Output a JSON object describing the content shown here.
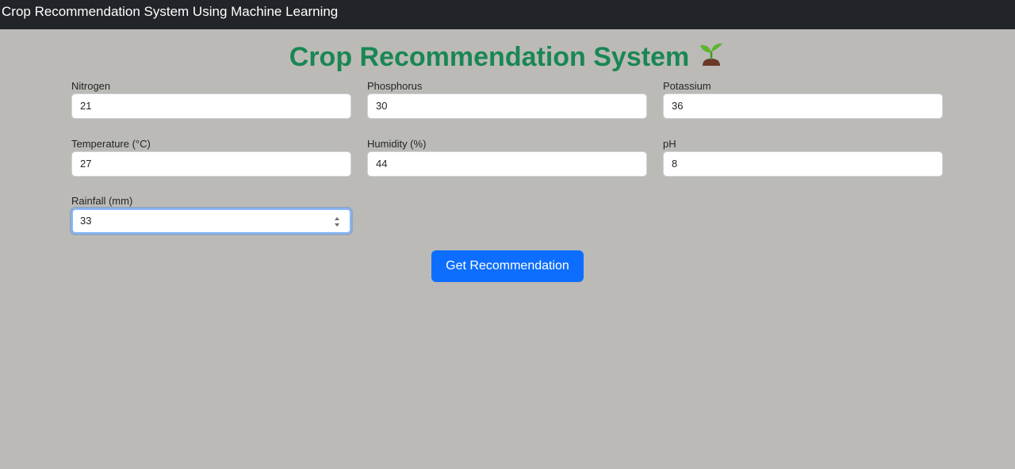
{
  "navbar": {
    "brand": "Crop Recommendation System Using Machine Learning"
  },
  "header": {
    "title": "Crop Recommendation System",
    "icon": "sprout-icon"
  },
  "form": {
    "fields": [
      {
        "label": "Nitrogen",
        "value": "21"
      },
      {
        "label": "Phosphorus",
        "value": "30"
      },
      {
        "label": "Potassium",
        "value": "36"
      },
      {
        "label": "Temperature (°C)",
        "value": "27"
      },
      {
        "label": "Humidity (%)",
        "value": "44"
      },
      {
        "label": "pH",
        "value": "8"
      },
      {
        "label": "Rainfall (mm)",
        "value": "33"
      }
    ],
    "submit_label": "Get Recommendation"
  },
  "colors": {
    "navbar_bg": "#212529",
    "page_bg": "#bcbab6",
    "title": "#198754",
    "button": "#0d6efd",
    "focus_ring": "#86b7fe"
  }
}
